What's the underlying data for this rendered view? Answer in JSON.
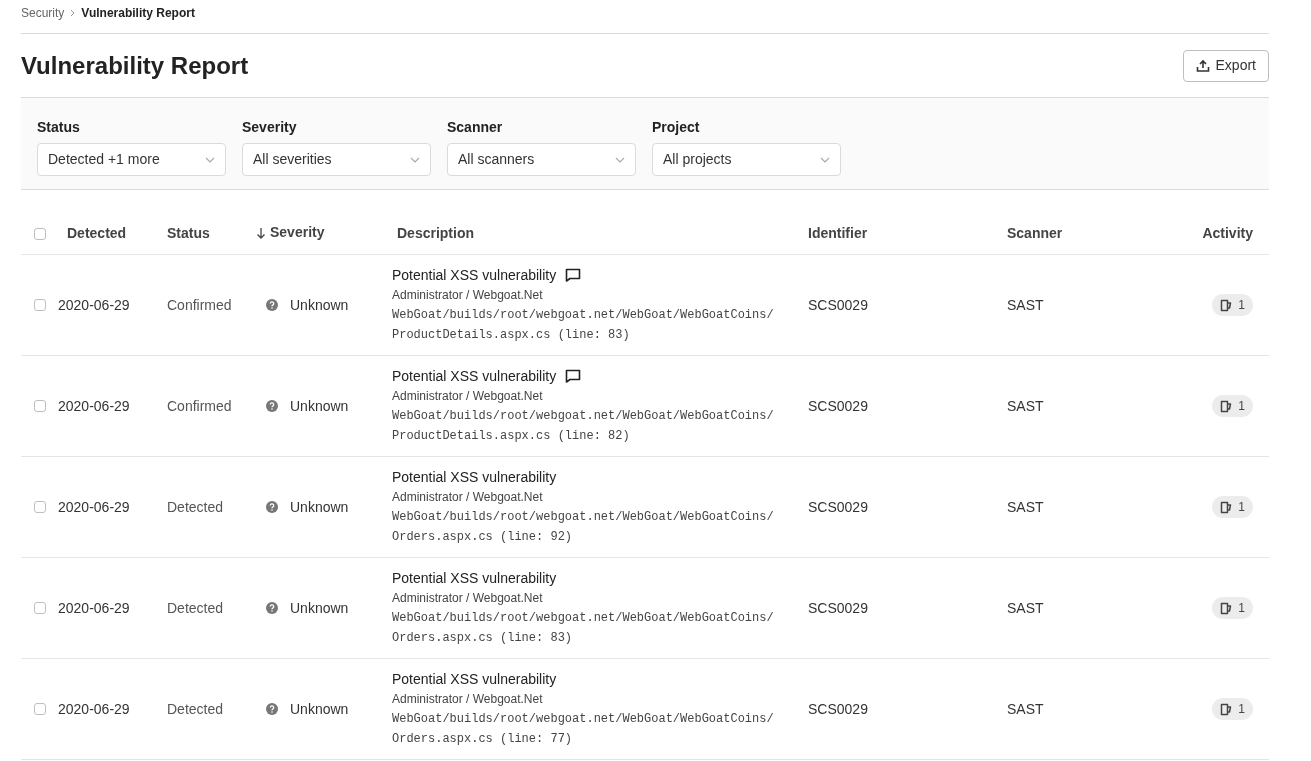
{
  "breadcrumb": [
    {
      "label": "Security",
      "current": false
    },
    {
      "label": "Vulnerability Report",
      "current": true
    }
  ],
  "title": "Vulnerability Report",
  "export_button": "Export",
  "filters": [
    {
      "label": "Status",
      "value": "Detected +1 more"
    },
    {
      "label": "Severity",
      "value": "All severities"
    },
    {
      "label": "Scanner",
      "value": "All scanners"
    },
    {
      "label": "Project",
      "value": "All projects"
    }
  ],
  "table": {
    "select_all": {
      "checked": false
    },
    "columns": [
      {
        "label": "Detected",
        "sorted": false
      },
      {
        "label": "Status",
        "sorted": false
      },
      {
        "label": "Severity",
        "sorted": true
      },
      {
        "label": "Description",
        "sorted": false
      },
      {
        "label": "Identifier",
        "sorted": false
      },
      {
        "label": "Scanner",
        "sorted": false
      },
      {
        "label": "Activity",
        "sorted": false
      }
    ],
    "rows": [
      {
        "checked": false,
        "detected": "2020-06-29",
        "status": "Confirmed",
        "severity": "Unknown",
        "title": "Potential XSS vulnerability",
        "has_comment": true,
        "project": "Administrator / Webgoat.Net",
        "location": "WebGoat/builds/root/webgoat.net/WebGoat/WebGoatCoins/ProductDetails.aspx.cs (line: 83)",
        "identifier": "SCS0029",
        "scanner": "SAST",
        "activity": "1"
      },
      {
        "checked": false,
        "detected": "2020-06-29",
        "status": "Confirmed",
        "severity": "Unknown",
        "title": "Potential XSS vulnerability",
        "has_comment": true,
        "project": "Administrator / Webgoat.Net",
        "location": "WebGoat/builds/root/webgoat.net/WebGoat/WebGoatCoins/ProductDetails.aspx.cs (line: 82)",
        "identifier": "SCS0029",
        "scanner": "SAST",
        "activity": "1"
      },
      {
        "checked": false,
        "detected": "2020-06-29",
        "status": "Detected",
        "severity": "Unknown",
        "title": "Potential XSS vulnerability",
        "has_comment": false,
        "project": "Administrator / Webgoat.Net",
        "location": "WebGoat/builds/root/webgoat.net/WebGoat/WebGoatCoins/Orders.aspx.cs (line: 92)",
        "identifier": "SCS0029",
        "scanner": "SAST",
        "activity": "1"
      },
      {
        "checked": false,
        "detected": "2020-06-29",
        "status": "Detected",
        "severity": "Unknown",
        "title": "Potential XSS vulnerability",
        "has_comment": false,
        "project": "Administrator / Webgoat.Net",
        "location": "WebGoat/builds/root/webgoat.net/WebGoat/WebGoatCoins/Orders.aspx.cs (line: 83)",
        "identifier": "SCS0029",
        "scanner": "SAST",
        "activity": "1"
      },
      {
        "checked": false,
        "detected": "2020-06-29",
        "status": "Detected",
        "severity": "Unknown",
        "title": "Potential XSS vulnerability",
        "has_comment": false,
        "project": "Administrator / Webgoat.Net",
        "location": "WebGoat/builds/root/webgoat.net/WebGoat/WebGoatCoins/Orders.aspx.cs (line: 77)",
        "identifier": "SCS0029",
        "scanner": "SAST",
        "activity": "1"
      }
    ]
  }
}
